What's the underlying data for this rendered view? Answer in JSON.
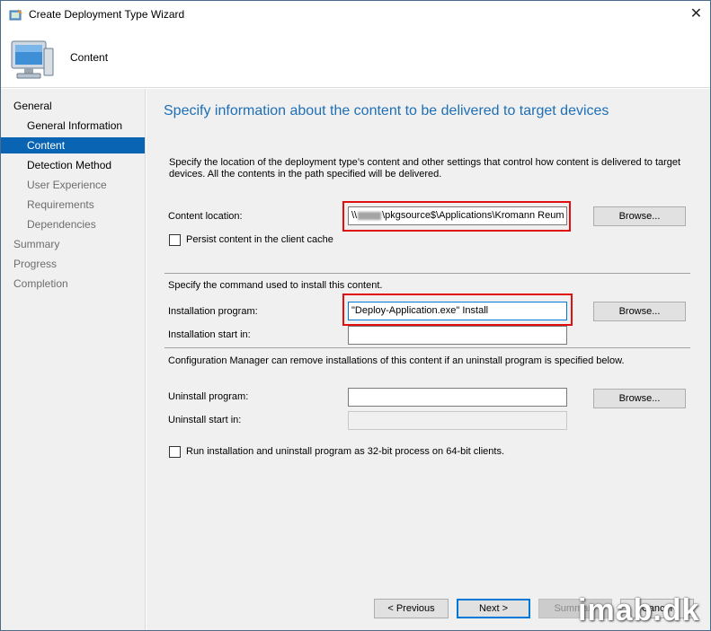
{
  "window": {
    "title": "Create Deployment Type Wizard",
    "close_glyph": "✕"
  },
  "header": {
    "title": "Content"
  },
  "sidebar": {
    "items": [
      {
        "label": "General"
      },
      {
        "label": "General Information"
      },
      {
        "label": "Content"
      },
      {
        "label": "Detection Method"
      },
      {
        "label": "User Experience"
      },
      {
        "label": "Requirements"
      },
      {
        "label": "Dependencies"
      },
      {
        "label": "Summary"
      },
      {
        "label": "Progress"
      },
      {
        "label": "Completion"
      }
    ]
  },
  "main": {
    "heading": "Specify information about the content to be delivered to target devices",
    "description": "Specify the location of the deployment type’s content and other settings that control how content is delivered to target devices. All the contents in the path specified will be delivered.",
    "content_location": {
      "label": "Content location:",
      "value_prefix": "\\\\",
      "value_suffix": "\\pkgsource$\\Applications\\Kromann Reum",
      "browse": "Browse..."
    },
    "persist_cache": {
      "label": "Persist content in the client cache",
      "checked": false
    },
    "install_section": "Specify the command used to install this content.",
    "installation_program": {
      "label": "Installation program:",
      "value": "\"Deploy-Application.exe\" Install",
      "browse": "Browse..."
    },
    "installation_start_in": {
      "label": "Installation start in:",
      "value": ""
    },
    "uninstall_section": "Configuration Manager can remove installations of this content if an uninstall program is specified below.",
    "uninstall_program": {
      "label": "Uninstall program:",
      "value": "",
      "browse": "Browse..."
    },
    "uninstall_start_in": {
      "label": "Uninstall start in:",
      "value": ""
    },
    "run_32bit": {
      "label": "Run installation and uninstall program as 32-bit process on 64-bit clients.",
      "checked": false
    }
  },
  "footer": {
    "previous": "< Previous",
    "next": "Next >",
    "summary": "Summary",
    "cancel": "Cancel"
  },
  "watermark": "imab.dk",
  "colors": {
    "accent": "#0a64b4",
    "heading": "#1e6fb6",
    "highlight": "#e01010"
  }
}
